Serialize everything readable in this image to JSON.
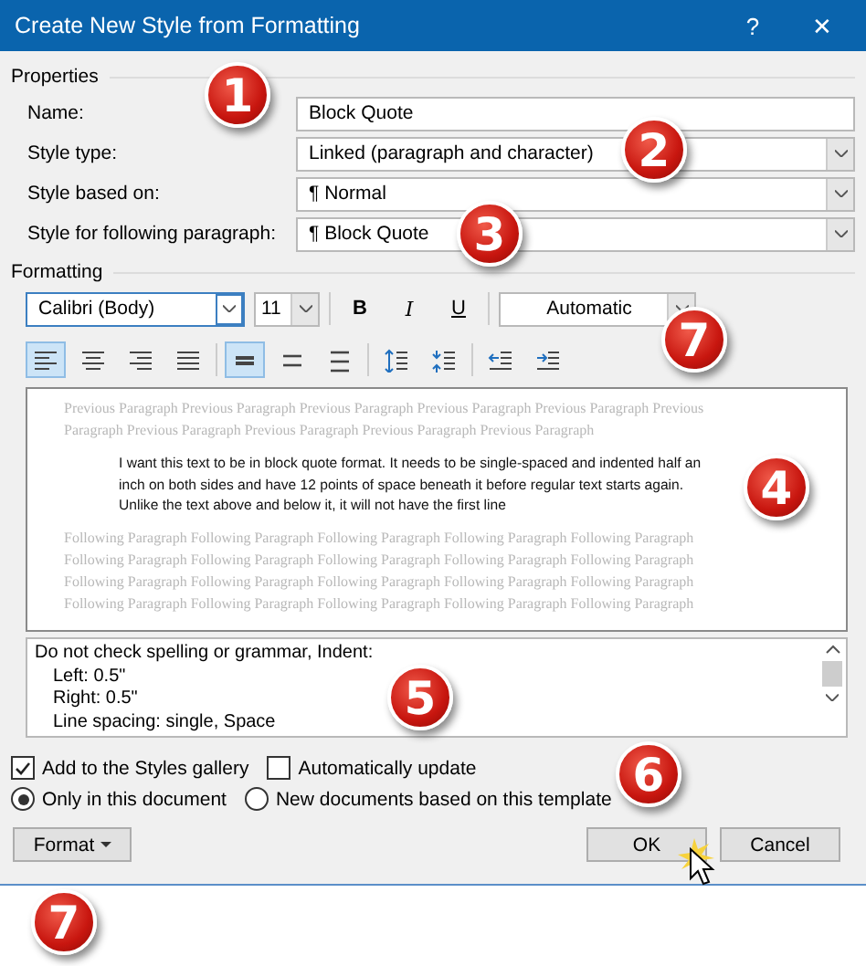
{
  "window": {
    "title": "Create New Style from Formatting",
    "help": "?",
    "close": "✕"
  },
  "properties": {
    "heading": "Properties",
    "fields": [
      {
        "label": "Name:",
        "value": "Block Quote",
        "kind": "text"
      },
      {
        "label": "Style type:",
        "value": "Linked (paragraph and character)",
        "kind": "select"
      },
      {
        "label": "Style based on:",
        "value": "Normal",
        "kind": "select",
        "mark": "¶"
      },
      {
        "label": "Style for following paragraph:",
        "value": "Block Quote",
        "kind": "select",
        "mark": "¶"
      }
    ]
  },
  "formatting": {
    "heading": "Formatting",
    "font": "Calibri (Body)",
    "size": "11",
    "bold": "B",
    "italic": "I",
    "underline": "U",
    "font_color": "Automatic",
    "tools": [
      {
        "kind": "align-left",
        "selected": true
      },
      {
        "kind": "align-center",
        "selected": false
      },
      {
        "kind": "align-right",
        "selected": false
      },
      {
        "kind": "justify",
        "selected": false
      },
      {
        "kind": "sep"
      },
      {
        "kind": "single",
        "selected": true
      },
      {
        "kind": "onehalf",
        "selected": false
      },
      {
        "kind": "double",
        "selected": false
      },
      {
        "kind": "sep"
      },
      {
        "kind": "space-up"
      },
      {
        "kind": "space-down"
      },
      {
        "kind": "sep"
      },
      {
        "kind": "outdent"
      },
      {
        "kind": "indent"
      }
    ]
  },
  "preview": {
    "previous": [
      "Previous Paragraph Previous Paragraph Previous Paragraph Previous Paragraph Previous Paragraph Previous",
      "Paragraph Previous Paragraph Previous Paragraph Previous Paragraph Previous Paragraph"
    ],
    "sample": "I want this text to be in block quote format. It needs to be single-spaced and indented half an inch on both sides and have 12 points of space beneath it before regular text starts again. Unlike the text above and below it, it will not have the first line",
    "following": [
      "Following Paragraph Following Paragraph Following Paragraph Following Paragraph Following Paragraph",
      "Following Paragraph Following Paragraph Following Paragraph Following Paragraph Following Paragraph",
      "Following Paragraph Following Paragraph Following Paragraph Following Paragraph Following Paragraph",
      "Following Paragraph Following Paragraph Following Paragraph Following Paragraph Following Paragraph"
    ]
  },
  "description": [
    "Do not check spelling or grammar, Indent:",
    "Left:  0.5\"",
    "Right:  0.5\"",
    "Line spacing:  single, Space"
  ],
  "options": [
    {
      "label": "Add to the Styles gallery",
      "checked": true
    },
    {
      "label": "Automatically update",
      "checked": false
    }
  ],
  "scope": [
    {
      "label": "Only in this document",
      "selected": true
    },
    {
      "label": "New documents based on this template",
      "selected": false
    }
  ],
  "buttons": {
    "format": "Format",
    "ok": "OK",
    "cancel": "Cancel"
  },
  "callouts": [
    "1",
    "2",
    "3",
    "7",
    "4",
    "5",
    "6",
    "7"
  ]
}
